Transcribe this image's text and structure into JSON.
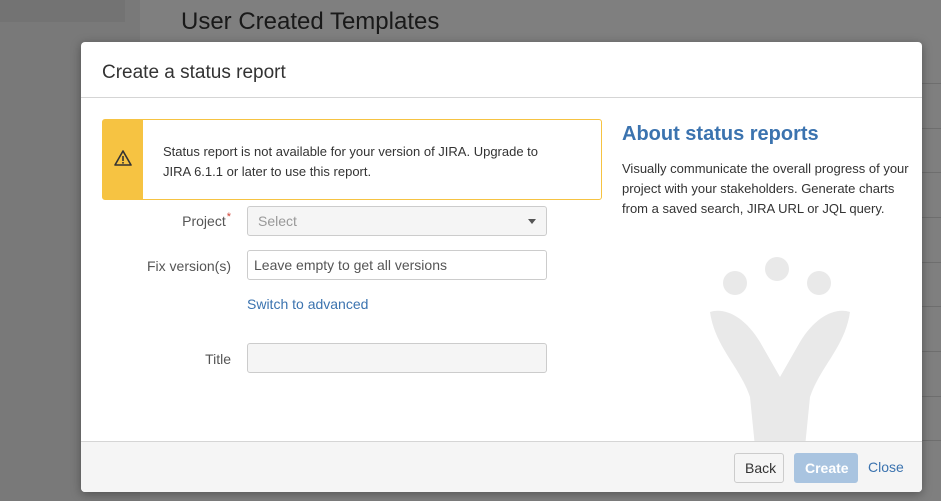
{
  "background": {
    "heading": "User Created Templates"
  },
  "dialog": {
    "title": "Create a status report",
    "warning": {
      "icon": "warning-icon",
      "text": "Status report is not available for your version of JIRA. Upgrade to JIRA 6.1.1 or later to use this report."
    },
    "form": {
      "project_label": "Project",
      "required_marker": "*",
      "project_placeholder": "Select",
      "fix_version_label": "Fix version(s)",
      "fix_version_placeholder": "Leave empty to get all versions",
      "switch_link": "Switch to advanced",
      "title_label": "Title",
      "title_value": ""
    },
    "about": {
      "title": "About status reports",
      "text": "Visually communicate the overall progress of your project with your stakeholders. Generate charts from a saved search, JIRA URL or JQL query.",
      "logo": "jira-logo-icon"
    },
    "footer": {
      "back": "Back",
      "create": "Create",
      "close": "Close"
    }
  },
  "colors": {
    "accent": "#3b73af",
    "warning": "#f6c342",
    "required": "#d04437",
    "create_disabled": "#a9c4e0"
  }
}
